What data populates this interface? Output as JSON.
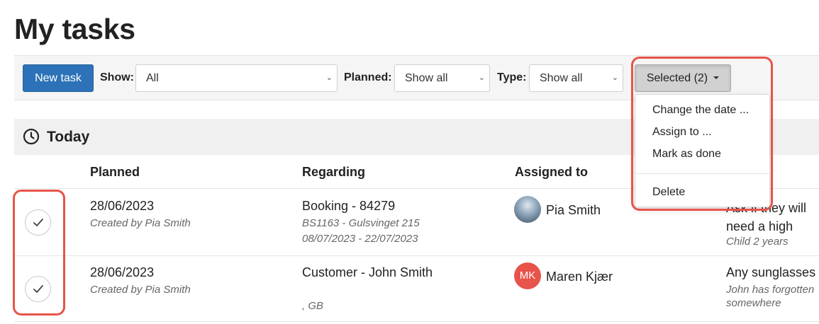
{
  "page": {
    "title": "My tasks"
  },
  "toolbar": {
    "new_task_label": "New task",
    "show_label": "Show:",
    "show_value": "All",
    "planned_label": "Planned:",
    "planned_value": "Show all",
    "type_label": "Type:",
    "type_value": "Show all",
    "selected_label": "Selected (2)"
  },
  "dropdown": {
    "items": [
      "Change the date ...",
      "Assign to ...",
      "Mark as done",
      "Delete"
    ]
  },
  "section": {
    "title": "Today"
  },
  "table": {
    "columns": [
      "Planned",
      "Regarding",
      "Assigned to"
    ],
    "rows": [
      {
        "planned": "28/06/2023",
        "created": "Created by Pia Smith",
        "regarding": "Booking - 84279",
        "regarding_sub1": "BS1163 - Gulsvinget 215",
        "regarding_sub2": "08/07/2023 - 22/07/2023",
        "assigned": "Pia Smith",
        "note": "Ask if they will need a high chair for the",
        "note_sub": "Child 2 years"
      },
      {
        "planned": "28/06/2023",
        "created": "Created by Pia Smith",
        "regarding": "Customer - John Smith",
        "regarding_sub1": "",
        "regarding_sub2": ", GB",
        "assigned": "Maren Kjær",
        "assigned_initials": "MK",
        "note": "Any sunglasses",
        "note_sub": "John has forgotten somewhere"
      }
    ]
  },
  "icons": {
    "clock": "clock-icon",
    "check": "check-icon",
    "chevron": "chevron-down-icon"
  },
  "colors": {
    "primary": "#2d72b8",
    "highlight": "#e8534a",
    "avatar_mk": "#e8534a"
  }
}
